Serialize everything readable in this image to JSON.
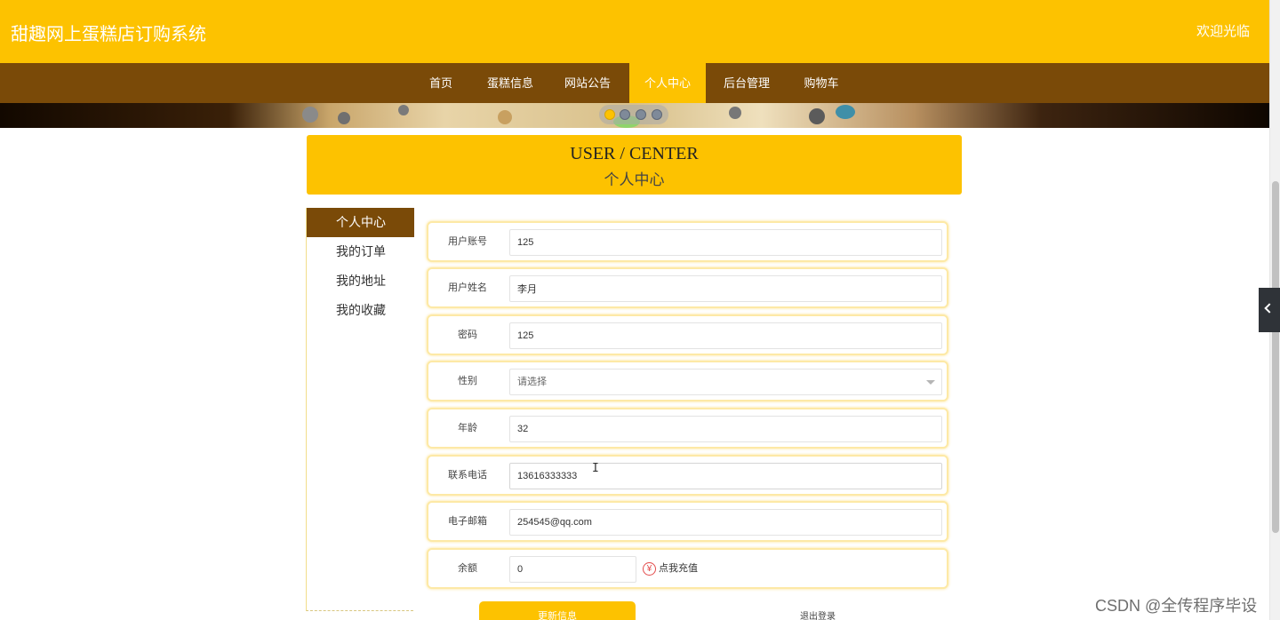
{
  "header": {
    "site_title": "甜趣网上蛋糕店订购系统",
    "welcome": "欢迎光临"
  },
  "nav": {
    "items": [
      {
        "label": "首页"
      },
      {
        "label": "蛋糕信息"
      },
      {
        "label": "网站公告"
      },
      {
        "label": "个人中心",
        "active": true
      },
      {
        "label": "后台管理"
      },
      {
        "label": "购物车"
      }
    ]
  },
  "banner": {
    "carousel_active_index": 1,
    "carousel_count": 4
  },
  "page_header": {
    "title_en": "USER / CENTER",
    "title_zh": "个人中心"
  },
  "sidebar": {
    "items": [
      {
        "label": "个人中心",
        "active": true
      },
      {
        "label": "我的订单"
      },
      {
        "label": "我的地址"
      },
      {
        "label": "我的收藏"
      }
    ]
  },
  "form": {
    "username": {
      "label": "用户账号",
      "value": "125"
    },
    "realname": {
      "label": "用户姓名",
      "value": "李月"
    },
    "password": {
      "label": "密码",
      "value": "125"
    },
    "gender": {
      "label": "性别",
      "selected": "请选择"
    },
    "age": {
      "label": "年龄",
      "value": "32"
    },
    "phone": {
      "label": "联系电话",
      "value": "13616333333"
    },
    "email": {
      "label": "电子邮箱",
      "value": "254545@qq.com"
    },
    "balance": {
      "label": "余额",
      "value": "0",
      "recharge_label": "点我充值",
      "recharge_icon": "¥"
    }
  },
  "actions": {
    "update_label": "更新信息",
    "logout_label": "退出登录"
  },
  "watermark": "CSDN @全传程序毕设",
  "colors": {
    "accent": "#fdc200",
    "nav_bg": "#7a4a08",
    "active_side": "#7a4a08"
  }
}
